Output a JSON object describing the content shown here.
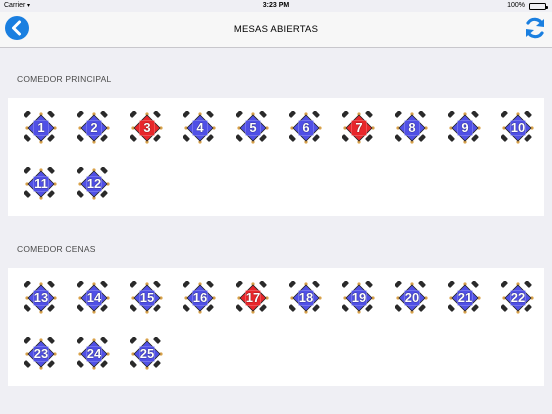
{
  "status_bar": {
    "carrier": "Carrier",
    "time": "3:23 PM",
    "battery": "100%",
    "battery_level": 1.0
  },
  "nav": {
    "title": "MESAS ABIERTAS",
    "back_icon": "chevron-left-icon",
    "refresh_icon": "refresh-icon",
    "accent": "#1a7fe0"
  },
  "colors": {
    "free": "#5050e6",
    "occupied": "#e8262b",
    "chair": "#2a2a2a"
  },
  "sections": [
    {
      "label": "COMEDOR PRINCIPAL",
      "tables": [
        {
          "number": "1",
          "occupied": false
        },
        {
          "number": "2",
          "occupied": false
        },
        {
          "number": "3",
          "occupied": true
        },
        {
          "number": "4",
          "occupied": false
        },
        {
          "number": "5",
          "occupied": false
        },
        {
          "number": "6",
          "occupied": false
        },
        {
          "number": "7",
          "occupied": true
        },
        {
          "number": "8",
          "occupied": false
        },
        {
          "number": "9",
          "occupied": false
        },
        {
          "number": "10",
          "occupied": false
        },
        {
          "number": "11",
          "occupied": false
        },
        {
          "number": "12",
          "occupied": false
        }
      ]
    },
    {
      "label": "COMEDOR CENAS",
      "tables": [
        {
          "number": "13",
          "occupied": false
        },
        {
          "number": "14",
          "occupied": false
        },
        {
          "number": "15",
          "occupied": false
        },
        {
          "number": "16",
          "occupied": false
        },
        {
          "number": "17",
          "occupied": true
        },
        {
          "number": "18",
          "occupied": false
        },
        {
          "number": "19",
          "occupied": false
        },
        {
          "number": "20",
          "occupied": false
        },
        {
          "number": "21",
          "occupied": false
        },
        {
          "number": "22",
          "occupied": false
        },
        {
          "number": "23",
          "occupied": false
        },
        {
          "number": "24",
          "occupied": false
        },
        {
          "number": "25",
          "occupied": false
        }
      ]
    }
  ]
}
